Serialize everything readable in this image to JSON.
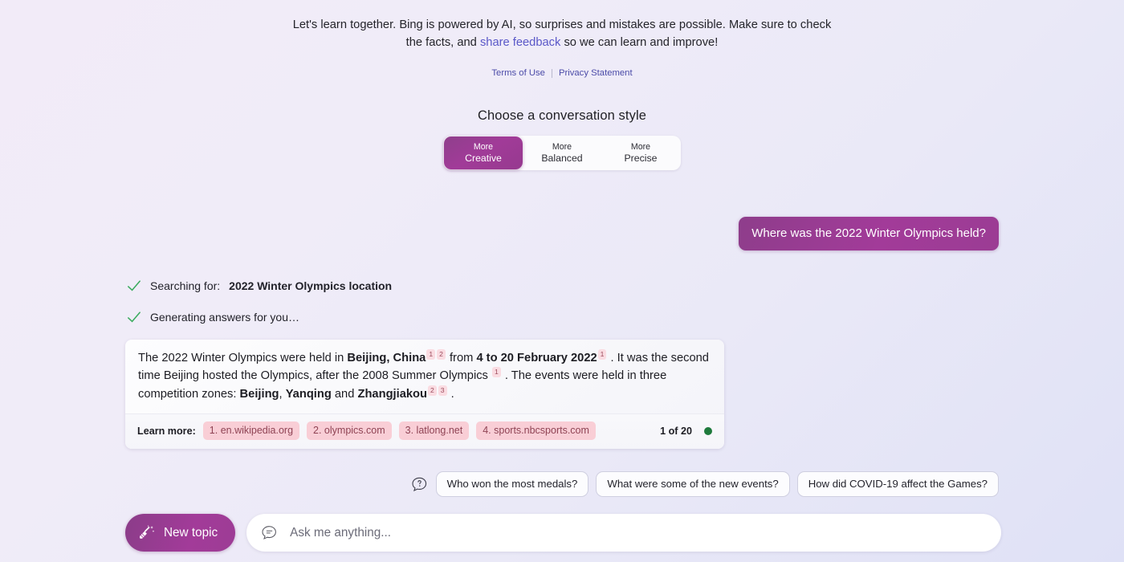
{
  "disclaimer": {
    "text_before": "Let's learn together. Bing is powered by AI, so surprises and mistakes are possible. Make sure to check the facts, and ",
    "link_label": "share feedback",
    "text_after": " so we can learn and improve!",
    "terms_label": "Terms of Use",
    "privacy_label": "Privacy Statement",
    "link_color": "#5a58c8"
  },
  "style_selector": {
    "title": "Choose a conversation style",
    "options": [
      {
        "line1": "More",
        "line2": "Creative",
        "selected": true
      },
      {
        "line1": "More",
        "line2": "Balanced",
        "selected": false
      },
      {
        "line1": "More",
        "line2": "Precise",
        "selected": false
      }
    ],
    "selected_color": "#a13b98"
  },
  "conversation": {
    "user_message": "Where was the 2022 Winter Olympics held?",
    "status": [
      {
        "icon": "check-icon",
        "prefix": "Searching for: ",
        "query": "2022 Winter Olympics location"
      },
      {
        "icon": "check-icon",
        "prefix": "Generating answers for you…",
        "query": ""
      }
    ],
    "status_check_color": "#3aab5e",
    "answer": {
      "segments": [
        {
          "type": "text",
          "value": "The 2022 Winter Olympics were held in "
        },
        {
          "type": "bold",
          "value": "Beijing, China"
        },
        {
          "type": "cite",
          "value": "1"
        },
        {
          "type": "cite",
          "value": "2"
        },
        {
          "type": "text",
          "value": " from "
        },
        {
          "type": "bold",
          "value": "4 to 20 February 2022"
        },
        {
          "type": "cite",
          "value": "1"
        },
        {
          "type": "text",
          "value": " . It was the second time Beijing hosted the Olympics, after the 2008 Summer Olympics "
        },
        {
          "type": "cite",
          "value": "1"
        },
        {
          "type": "text",
          "value": " . The events were held in three competition zones: "
        },
        {
          "type": "bold",
          "value": "Beijing"
        },
        {
          "type": "text",
          "value": ", "
        },
        {
          "type": "bold",
          "value": "Yanqing"
        },
        {
          "type": "text",
          "value": " and "
        },
        {
          "type": "bold",
          "value": "Zhangjiakou"
        },
        {
          "type": "cite",
          "value": "2"
        },
        {
          "type": "cite",
          "value": "3"
        },
        {
          "type": "text",
          "value": " ."
        }
      ],
      "plain_text": "The 2022 Winter Olympics were held in Beijing, China 1 2 from 4 to 20 February 2022 1 . It was the second time Beijing hosted the Olympics, after the 2008 Summer Olympics 1 . The events were held in three competition zones: Beijing, Yanqing and Zhangjiakou 2 3 .",
      "learn_more_label": "Learn more:",
      "sources": [
        "1. en.wikipedia.org",
        "2. olympics.com",
        "3. latlong.net",
        "4. sports.nbcsports.com"
      ],
      "page_count": "1 of 20",
      "status_dot_color": "#1e7a3c",
      "citation_bg": "#fadce2",
      "source_chip_bg": "#f9ced6"
    }
  },
  "suggestions": {
    "help_icon": "question-bubble-icon",
    "chips": [
      "Who won the most medals?",
      "What were some of the new events?",
      "How did COVID-19 affect the Games?"
    ]
  },
  "composer": {
    "new_topic_label": "New topic",
    "new_topic_icon": "broom-icon",
    "input_icon": "chat-bubble-icon",
    "input_value": "",
    "input_placeholder": "Ask me anything...",
    "accent_color": "#a23b99"
  }
}
